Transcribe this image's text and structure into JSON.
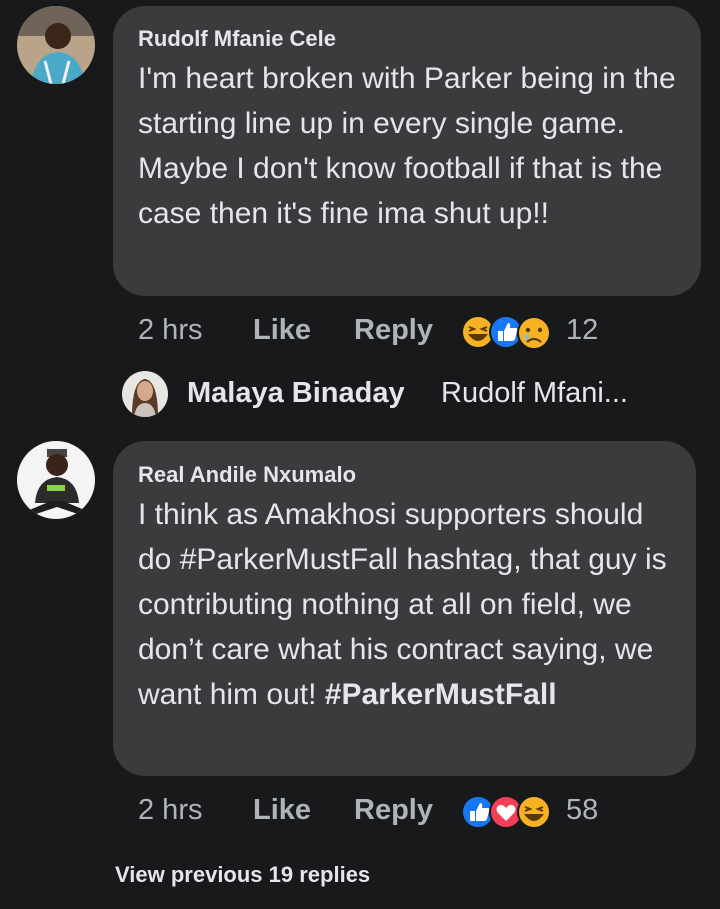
{
  "comments": [
    {
      "author": "Rudolf Mfanie Cele",
      "body": "I'm heart broken with Parker being in the starting line up in every single game. Maybe I don't know football if that is the case then it's fine ima shut up!!",
      "time": "2 hrs",
      "like_label": "Like",
      "reply_label": "Reply",
      "reaction_icons": [
        "haha-icon",
        "like-icon",
        "sad-icon"
      ],
      "reaction_count": "12"
    },
    {
      "author": "Real Andile Nxumalo",
      "body_plain": "I think as Amakhosi supporters should do #ParkerMustFall hashtag, that guy is contributing nothing at all on field, we don’t care what his contract saying, we want him out! ",
      "body_bold": "#ParkerMustFall",
      "time": "2 hrs",
      "like_label": "Like",
      "reply_label": "Reply",
      "reaction_icons": [
        "like-icon",
        "love-icon",
        "haha-icon"
      ],
      "reaction_count": "58"
    }
  ],
  "reply_preview": {
    "name": "Malaya Binaday",
    "text": "Rudolf Mfani..."
  },
  "view_previous": "View previous 19 replies",
  "colors": {
    "background": "#18191a",
    "bubble": "#3a3b3c",
    "text": "#e4e6eb",
    "secondary": "#b0b3b8",
    "like_blue": "#1877f2",
    "love_red": "#f33e58",
    "emoji_yellow": "#f7b125"
  }
}
